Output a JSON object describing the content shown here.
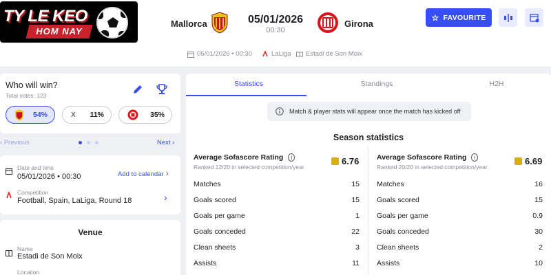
{
  "logo": {
    "line1": "TY LE KEO",
    "line2": "HOM NAY"
  },
  "match": {
    "home_team": "Mallorca",
    "away_team": "Girona",
    "date": "05/01/2026",
    "time": "00:30",
    "meta_datetime": "05/01/2026 • 00:30",
    "league": "LaLiga",
    "stadium": "Estadi de Son Moix"
  },
  "actions": {
    "favourite_label": "FAVOURITE"
  },
  "vote": {
    "title": "Who will win?",
    "total": "Total votes: 123",
    "home_pct": "54%",
    "draw_label": "X",
    "draw_pct": "11%",
    "away_pct": "35%"
  },
  "pager": {
    "previous": "Previous",
    "next": "Next"
  },
  "details": {
    "date_label": "Date and time",
    "date_value": "05/01/2026  •  00:30",
    "add_calendar": "Add to calendar",
    "competition_label": "Competition",
    "competition_value": "Football, Spain, LaLiga, Round 18"
  },
  "venue": {
    "title": "Venue",
    "name_label": "Name",
    "name_value": "Estadi de Son Moix",
    "location_label": "Location"
  },
  "tabs": [
    "Statistics",
    "Standings",
    "H2H"
  ],
  "notice": "Match & player stats will appear once the match has kicked off",
  "season": {
    "title": "Season statistics",
    "rating_title": "Average Sofascore Rating",
    "home": {
      "rating": "6.76",
      "rank_text": "Ranked 12/20 in selected competition/year",
      "stats": [
        {
          "label": "Matches",
          "value": "15"
        },
        {
          "label": "Goals scored",
          "value": "15"
        },
        {
          "label": "Goals per game",
          "value": "1"
        },
        {
          "label": "Goals conceded",
          "value": "22"
        },
        {
          "label": "Clean sheets",
          "value": "3"
        },
        {
          "label": "Assists",
          "value": "11"
        }
      ]
    },
    "away": {
      "rating": "6.69",
      "rank_text": "Ranked 20/20 in selected competition/year",
      "stats": [
        {
          "label": "Matches",
          "value": "16"
        },
        {
          "label": "Goals scored",
          "value": "15"
        },
        {
          "label": "Goals per game",
          "value": "0.9"
        },
        {
          "label": "Goals conceded",
          "value": "30"
        },
        {
          "label": "Clean sheets",
          "value": "2"
        },
        {
          "label": "Assists",
          "value": "10"
        }
      ]
    }
  },
  "colors": {
    "accent": "#374df5",
    "mallorca": "#c8102e",
    "girona": "#d7141a",
    "rating": "#d9b008"
  }
}
